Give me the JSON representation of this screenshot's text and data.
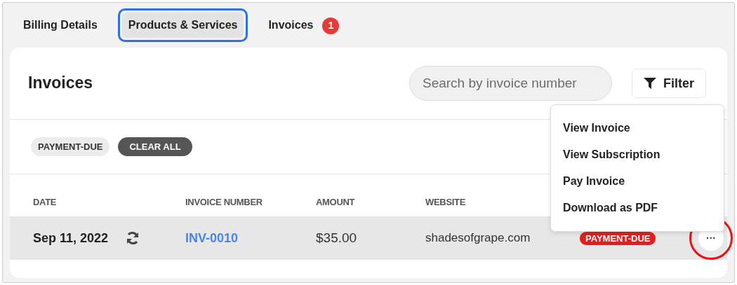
{
  "tabs": [
    {
      "label": "Billing Details",
      "selected": false,
      "highlighted": false
    },
    {
      "label": "Products & Services",
      "selected": true,
      "highlighted": true
    },
    {
      "label": "Invoices",
      "selected": false,
      "highlighted": false,
      "badge": "1"
    }
  ],
  "panel": {
    "title": "Invoices",
    "search": {
      "placeholder": "Search by invoice number"
    },
    "filter_button": "Filter"
  },
  "active_filters": {
    "chips": [
      "PAYMENT-DUE"
    ],
    "clear_button": "CLEAR ALL"
  },
  "table": {
    "columns": [
      "DATE",
      "INVOICE NUMBER",
      "AMOUNT",
      "WEBSITE"
    ],
    "rows": [
      {
        "date": "Sep 11, 2022",
        "recurring": true,
        "invoice_number": "INV-0010",
        "amount": "$35.00",
        "website": "shadesofgrape.com",
        "status": "PAYMENT-DUE",
        "more_button": "···",
        "actions_circled": true
      }
    ]
  },
  "actions_menu": {
    "items": [
      "View Invoice",
      "View Subscription",
      "Pay Invoice",
      "Download as PDF"
    ]
  }
}
